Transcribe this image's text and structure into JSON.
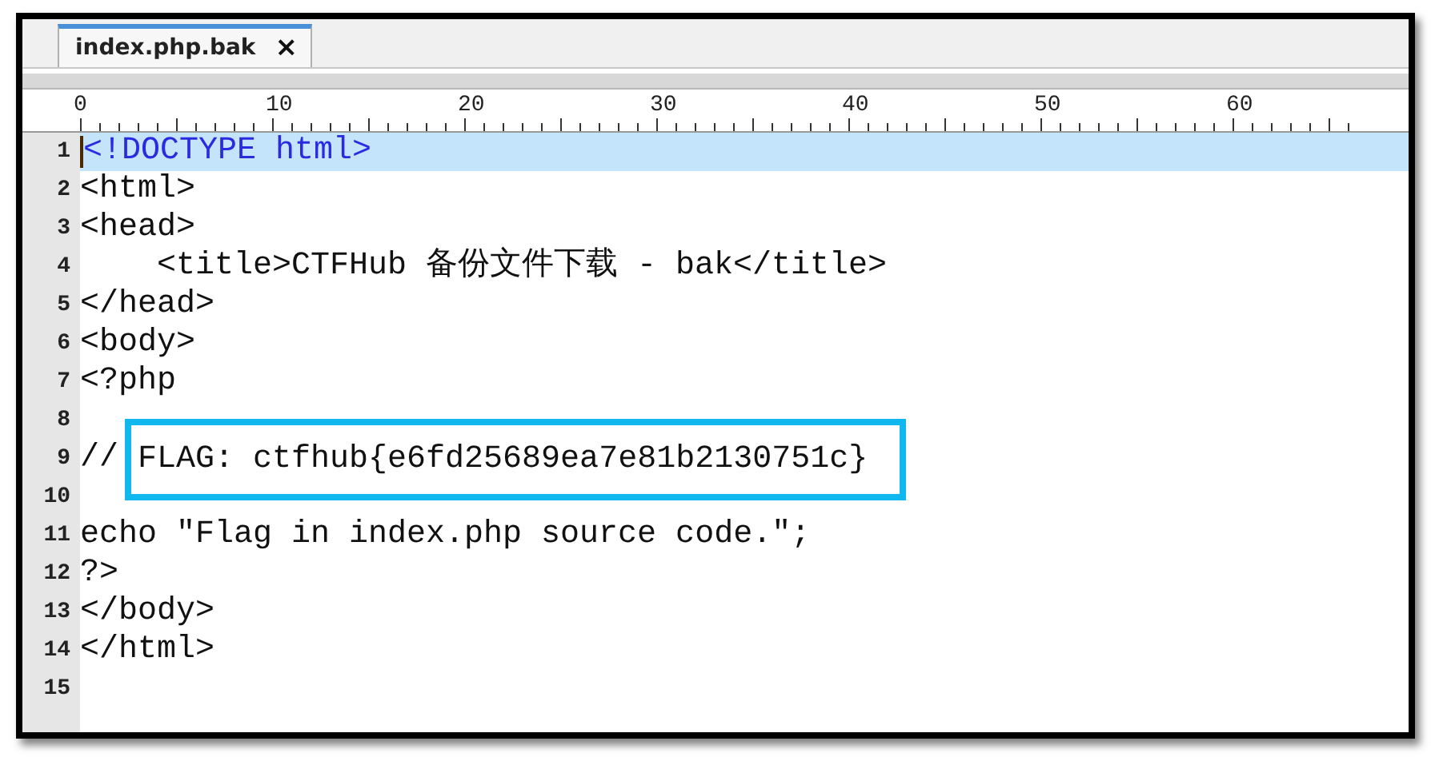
{
  "tabs": [
    {
      "label": "index.php.bak",
      "close": "×",
      "selected": true
    }
  ],
  "ruler": {
    "labels": [
      "0",
      "10",
      "20",
      "30",
      "40",
      "50",
      "60"
    ]
  },
  "lines": [
    {
      "number": "1",
      "kind": "doctype",
      "code": "<!DOCTYPE html>",
      "current": true
    },
    {
      "number": "2",
      "kind": "code",
      "code": "<html>",
      "current": false
    },
    {
      "number": "3",
      "kind": "code",
      "code": "<head>",
      "current": false
    },
    {
      "number": "4",
      "kind": "code",
      "code": "    <title>CTFHub 备份文件下载 - bak</title>",
      "current": false
    },
    {
      "number": "5",
      "kind": "code",
      "code": "</head>",
      "current": false
    },
    {
      "number": "6",
      "kind": "code",
      "code": "<body>",
      "current": false
    },
    {
      "number": "7",
      "kind": "code",
      "code": "<?php",
      "current": false
    },
    {
      "number": "8",
      "current": false
    },
    {
      "number": "9",
      "kind": "code",
      "code": "// ",
      "boxed": "FLAG: ctfhub{e6fd25689ea7e81b2130751c}",
      "current": false
    },
    {
      "number": "10",
      "current": false
    },
    {
      "number": "11",
      "kind": "code",
      "code": "echo \"Flag in index.php source code.\";",
      "current": false
    },
    {
      "number": "12",
      "kind": "code",
      "code": "?>",
      "current": false
    },
    {
      "number": "13",
      "kind": "code",
      "code": "</body>",
      "current": false
    },
    {
      "number": "14",
      "kind": "code",
      "code": "</html>",
      "current": false
    },
    {
      "number": "15",
      "current": false
    }
  ]
}
